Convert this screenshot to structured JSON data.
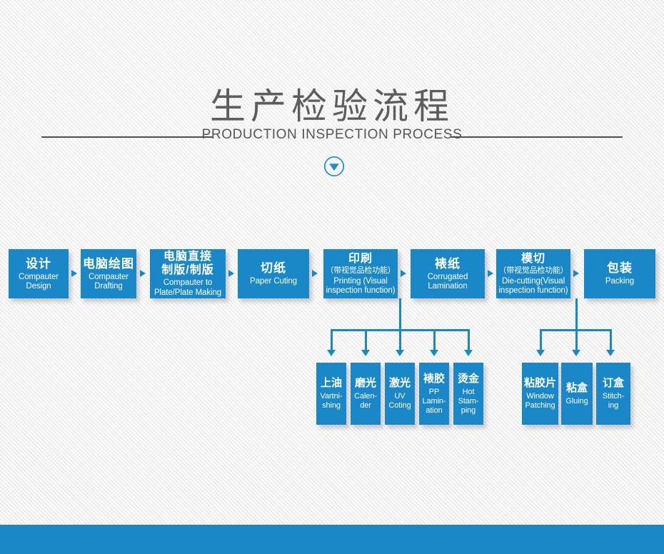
{
  "header": {
    "title": "生产检验流程",
    "subtitle": "PRODUCTION INSPECTION PROCESS",
    "chevron_icon": "chevron-down-circle-icon"
  },
  "colors": {
    "accent_blue": "#1a87c8",
    "title_gray": "#5d5d5d",
    "rule_gray": "#4f4f4f",
    "background": "#f6f6f6"
  },
  "flow": {
    "main_steps": [
      {
        "cn": "设计",
        "cn_sub": "",
        "en": "Compauter\nDesign"
      },
      {
        "cn": "电脑绘图",
        "cn_sub": "",
        "en": "Compauter\nDrafting"
      },
      {
        "cn": "电脑直接\n制版/制版",
        "cn_sub": "",
        "en": "Compauter to\nPlate/Plate Making"
      },
      {
        "cn": "切纸",
        "cn_sub": "",
        "en": "Paper Cuting"
      },
      {
        "cn": "印刷",
        "cn_sub": "（带视觉品检功能）",
        "en": "Printing (Visual\ninspection function)"
      },
      {
        "cn": "裱纸",
        "cn_sub": "",
        "en": "Corrugated\nLamination"
      },
      {
        "cn": "模切",
        "cn_sub": "（带视觉品检功能）",
        "en": "Die-cutting(Visual\ninspection function)"
      },
      {
        "cn": "包装",
        "cn_sub": "",
        "en": "Packing"
      }
    ],
    "printing_substeps": [
      {
        "cn": "上油",
        "en": "Vartni-\nshing"
      },
      {
        "cn": "磨光",
        "en": "Calen-\nder"
      },
      {
        "cn": "激光",
        "en": "UV\nCoting"
      },
      {
        "cn": "裱胶",
        "en": "PP\nLamin-\nation"
      },
      {
        "cn": "烫金",
        "en": "Hot\nStam-\nping"
      }
    ],
    "diecutting_substeps": [
      {
        "cn": "粘胶片",
        "en": "Window\nPatching"
      },
      {
        "cn": "粘盒",
        "en": "Gluing"
      },
      {
        "cn": "订盒",
        "en": "Stitch-\ning"
      }
    ],
    "step_arrow_icon": "arrow-right-icon",
    "branch_arrow_icon": "arrow-down-icon"
  }
}
